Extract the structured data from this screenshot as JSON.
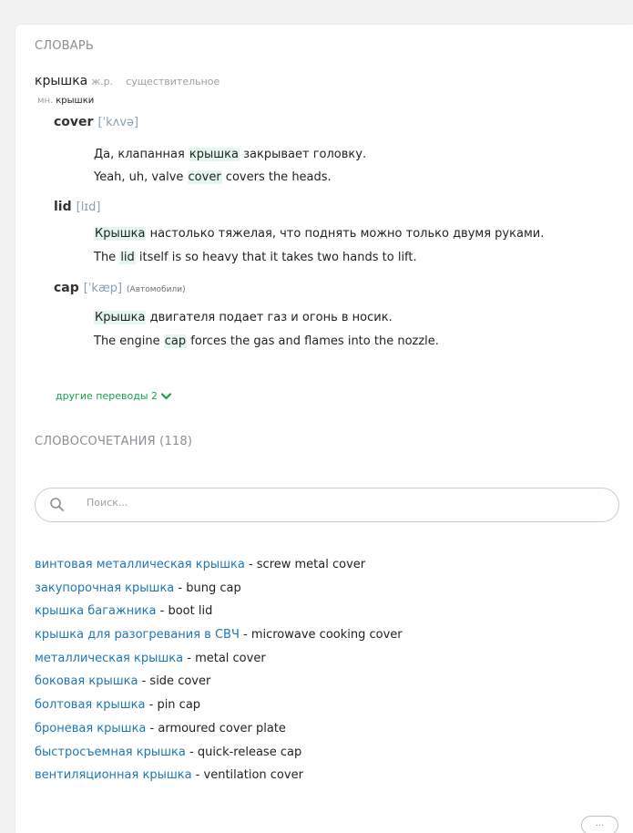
{
  "dictionary": {
    "section_title": "СЛОВАРЬ",
    "word": "крышка",
    "gender": "ж.р.",
    "part_of_speech": "существительное",
    "plural_label": "мн.",
    "plural_form": "крышки",
    "translations": [
      {
        "word": "cover",
        "ipa": "[ˈkʌvə]",
        "note": "",
        "example_ru": {
          "before": "Да, клапанная ",
          "highlight": "крышка",
          "after": " закрывает головку."
        },
        "example_en": {
          "before": "Yeah, uh, valve ",
          "highlight": "cover",
          "after": " covers the heads."
        }
      },
      {
        "word": "lid",
        "ipa": "[lɪd]",
        "note": "",
        "example_ru": {
          "before": "",
          "highlight": "Крышка",
          "after": " настолько тяжелая, что поднять можно только двумя руками."
        },
        "example_en": {
          "before": "The ",
          "highlight": "lid",
          "after": " itself is so heavy that it takes two hands to lift."
        }
      },
      {
        "word": "cap",
        "ipa": "[ˈkæp]",
        "note": "(Автомобили)",
        "example_ru": {
          "before": "",
          "highlight": "Крышка",
          "after": " двигателя подает газ и огонь в носик."
        },
        "example_en": {
          "before": "The engine ",
          "highlight": "cap",
          "after": " forces the gas and flames into the nozzle."
        }
      }
    ],
    "more_translations_label": "другие переводы 2",
    "more_translations_icon": "chevron-down-icon"
  },
  "phrases": {
    "section_title": "СЛОВОСОЧЕТАНИЯ (118)",
    "search_placeholder": "Поиск...",
    "search_icon": "search-icon",
    "separator": " - ",
    "items": [
      {
        "ru": "винтовая металлическая крышка",
        "en": "screw metal cover"
      },
      {
        "ru": "закупорочная крышка",
        "en": "bung cap"
      },
      {
        "ru": "крышка багажника",
        "en": "boot lid"
      },
      {
        "ru": "крышка для разогревания в СВЧ",
        "en": "microwave cooking cover"
      },
      {
        "ru": "металлическая крышка",
        "en": "metal cover"
      },
      {
        "ru": "боковая крышка",
        "en": "side cover"
      },
      {
        "ru": "болтовая крышка",
        "en": "pin cap"
      },
      {
        "ru": "броневая крышка",
        "en": "armoured cover plate"
      },
      {
        "ru": "быстросъемная крышка",
        "en": "quick-release cap"
      },
      {
        "ru": "вентиляционная крышка",
        "en": "ventilation cover"
      }
    ],
    "more_button_label": "..."
  },
  "colors": {
    "link_blue": "#1d77b6",
    "accent_green": "#16a04b",
    "highlight_green": "#e4f6ee",
    "muted_gray": "#8a8f95"
  }
}
